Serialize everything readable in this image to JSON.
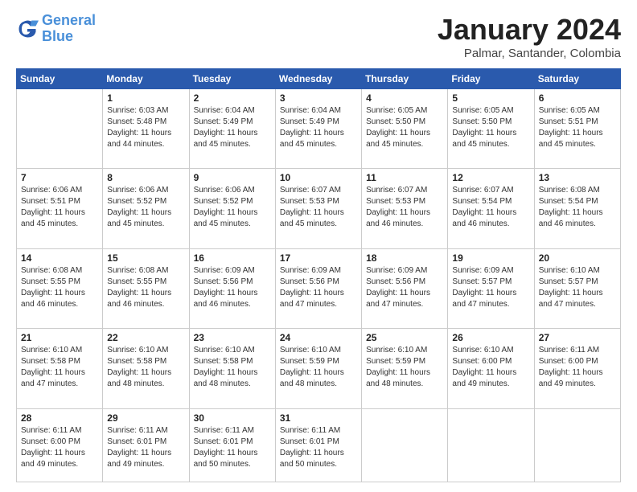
{
  "logo": {
    "line1": "General",
    "line2": "Blue"
  },
  "title": "January 2024",
  "location": "Palmar, Santander, Colombia",
  "days_header": [
    "Sunday",
    "Monday",
    "Tuesday",
    "Wednesday",
    "Thursday",
    "Friday",
    "Saturday"
  ],
  "weeks": [
    [
      {
        "day": "",
        "sunrise": "",
        "sunset": "",
        "daylight": ""
      },
      {
        "day": "1",
        "sunrise": "Sunrise: 6:03 AM",
        "sunset": "Sunset: 5:48 PM",
        "daylight": "Daylight: 11 hours and 44 minutes."
      },
      {
        "day": "2",
        "sunrise": "Sunrise: 6:04 AM",
        "sunset": "Sunset: 5:49 PM",
        "daylight": "Daylight: 11 hours and 45 minutes."
      },
      {
        "day": "3",
        "sunrise": "Sunrise: 6:04 AM",
        "sunset": "Sunset: 5:49 PM",
        "daylight": "Daylight: 11 hours and 45 minutes."
      },
      {
        "day": "4",
        "sunrise": "Sunrise: 6:05 AM",
        "sunset": "Sunset: 5:50 PM",
        "daylight": "Daylight: 11 hours and 45 minutes."
      },
      {
        "day": "5",
        "sunrise": "Sunrise: 6:05 AM",
        "sunset": "Sunset: 5:50 PM",
        "daylight": "Daylight: 11 hours and 45 minutes."
      },
      {
        "day": "6",
        "sunrise": "Sunrise: 6:05 AM",
        "sunset": "Sunset: 5:51 PM",
        "daylight": "Daylight: 11 hours and 45 minutes."
      }
    ],
    [
      {
        "day": "7",
        "sunrise": "Sunrise: 6:06 AM",
        "sunset": "Sunset: 5:51 PM",
        "daylight": "Daylight: 11 hours and 45 minutes."
      },
      {
        "day": "8",
        "sunrise": "Sunrise: 6:06 AM",
        "sunset": "Sunset: 5:52 PM",
        "daylight": "Daylight: 11 hours and 45 minutes."
      },
      {
        "day": "9",
        "sunrise": "Sunrise: 6:06 AM",
        "sunset": "Sunset: 5:52 PM",
        "daylight": "Daylight: 11 hours and 45 minutes."
      },
      {
        "day": "10",
        "sunrise": "Sunrise: 6:07 AM",
        "sunset": "Sunset: 5:53 PM",
        "daylight": "Daylight: 11 hours and 45 minutes."
      },
      {
        "day": "11",
        "sunrise": "Sunrise: 6:07 AM",
        "sunset": "Sunset: 5:53 PM",
        "daylight": "Daylight: 11 hours and 46 minutes."
      },
      {
        "day": "12",
        "sunrise": "Sunrise: 6:07 AM",
        "sunset": "Sunset: 5:54 PM",
        "daylight": "Daylight: 11 hours and 46 minutes."
      },
      {
        "day": "13",
        "sunrise": "Sunrise: 6:08 AM",
        "sunset": "Sunset: 5:54 PM",
        "daylight": "Daylight: 11 hours and 46 minutes."
      }
    ],
    [
      {
        "day": "14",
        "sunrise": "Sunrise: 6:08 AM",
        "sunset": "Sunset: 5:55 PM",
        "daylight": "Daylight: 11 hours and 46 minutes."
      },
      {
        "day": "15",
        "sunrise": "Sunrise: 6:08 AM",
        "sunset": "Sunset: 5:55 PM",
        "daylight": "Daylight: 11 hours and 46 minutes."
      },
      {
        "day": "16",
        "sunrise": "Sunrise: 6:09 AM",
        "sunset": "Sunset: 5:56 PM",
        "daylight": "Daylight: 11 hours and 46 minutes."
      },
      {
        "day": "17",
        "sunrise": "Sunrise: 6:09 AM",
        "sunset": "Sunset: 5:56 PM",
        "daylight": "Daylight: 11 hours and 47 minutes."
      },
      {
        "day": "18",
        "sunrise": "Sunrise: 6:09 AM",
        "sunset": "Sunset: 5:56 PM",
        "daylight": "Daylight: 11 hours and 47 minutes."
      },
      {
        "day": "19",
        "sunrise": "Sunrise: 6:09 AM",
        "sunset": "Sunset: 5:57 PM",
        "daylight": "Daylight: 11 hours and 47 minutes."
      },
      {
        "day": "20",
        "sunrise": "Sunrise: 6:10 AM",
        "sunset": "Sunset: 5:57 PM",
        "daylight": "Daylight: 11 hours and 47 minutes."
      }
    ],
    [
      {
        "day": "21",
        "sunrise": "Sunrise: 6:10 AM",
        "sunset": "Sunset: 5:58 PM",
        "daylight": "Daylight: 11 hours and 47 minutes."
      },
      {
        "day": "22",
        "sunrise": "Sunrise: 6:10 AM",
        "sunset": "Sunset: 5:58 PM",
        "daylight": "Daylight: 11 hours and 48 minutes."
      },
      {
        "day": "23",
        "sunrise": "Sunrise: 6:10 AM",
        "sunset": "Sunset: 5:58 PM",
        "daylight": "Daylight: 11 hours and 48 minutes."
      },
      {
        "day": "24",
        "sunrise": "Sunrise: 6:10 AM",
        "sunset": "Sunset: 5:59 PM",
        "daylight": "Daylight: 11 hours and 48 minutes."
      },
      {
        "day": "25",
        "sunrise": "Sunrise: 6:10 AM",
        "sunset": "Sunset: 5:59 PM",
        "daylight": "Daylight: 11 hours and 48 minutes."
      },
      {
        "day": "26",
        "sunrise": "Sunrise: 6:10 AM",
        "sunset": "Sunset: 6:00 PM",
        "daylight": "Daylight: 11 hours and 49 minutes."
      },
      {
        "day": "27",
        "sunrise": "Sunrise: 6:11 AM",
        "sunset": "Sunset: 6:00 PM",
        "daylight": "Daylight: 11 hours and 49 minutes."
      }
    ],
    [
      {
        "day": "28",
        "sunrise": "Sunrise: 6:11 AM",
        "sunset": "Sunset: 6:00 PM",
        "daylight": "Daylight: 11 hours and 49 minutes."
      },
      {
        "day": "29",
        "sunrise": "Sunrise: 6:11 AM",
        "sunset": "Sunset: 6:01 PM",
        "daylight": "Daylight: 11 hours and 49 minutes."
      },
      {
        "day": "30",
        "sunrise": "Sunrise: 6:11 AM",
        "sunset": "Sunset: 6:01 PM",
        "daylight": "Daylight: 11 hours and 50 minutes."
      },
      {
        "day": "31",
        "sunrise": "Sunrise: 6:11 AM",
        "sunset": "Sunset: 6:01 PM",
        "daylight": "Daylight: 11 hours and 50 minutes."
      },
      {
        "day": "",
        "sunrise": "",
        "sunset": "",
        "daylight": ""
      },
      {
        "day": "",
        "sunrise": "",
        "sunset": "",
        "daylight": ""
      },
      {
        "day": "",
        "sunrise": "",
        "sunset": "",
        "daylight": ""
      }
    ]
  ]
}
